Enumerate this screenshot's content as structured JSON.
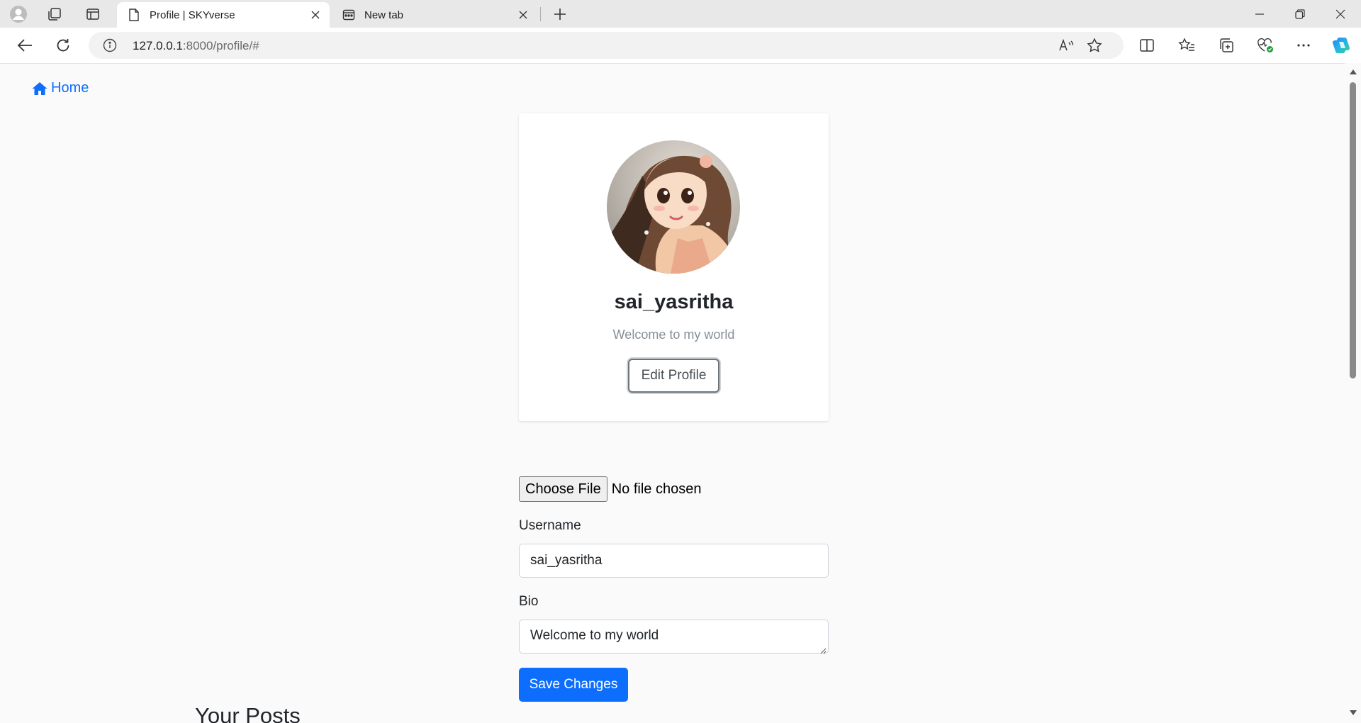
{
  "browser": {
    "tabs": [
      {
        "title": "Profile | SKYverse",
        "icon": "page-icon",
        "active": true
      },
      {
        "title": "New tab",
        "icon": "newtab-icon",
        "active": false
      }
    ],
    "address": {
      "host": "127.0.0.1",
      "path": ":8000/profile/#"
    }
  },
  "nav": {
    "home_label": "Home"
  },
  "profile": {
    "username": "sai_yasritha",
    "bio": "Welcome to my world",
    "edit_button_label": "Edit Profile"
  },
  "form": {
    "file_button_label": "Choose File",
    "file_status": "No file chosen",
    "username_label": "Username",
    "username_value": "sai_yasritha",
    "bio_label": "Bio",
    "bio_value": "Welcome to my world",
    "save_button_label": "Save Changes"
  },
  "posts": {
    "heading": "Your Posts"
  },
  "colors": {
    "primary": "#0d6efd",
    "background": "#fafafa"
  }
}
